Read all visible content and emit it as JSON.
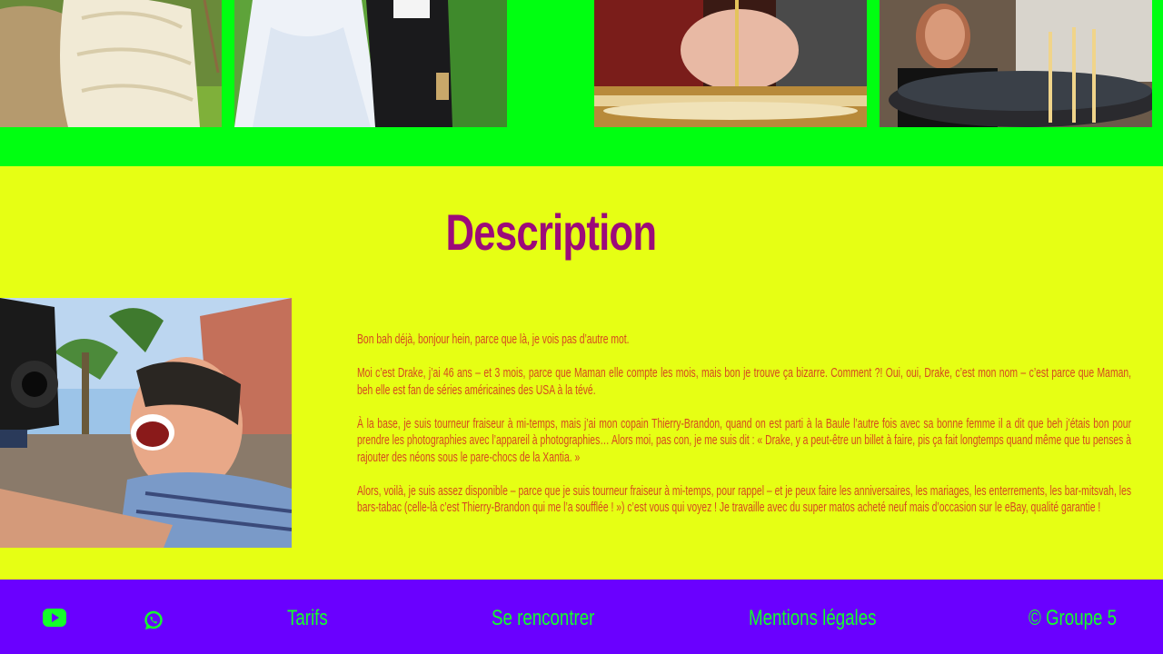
{
  "description": {
    "title": "Description",
    "paragraphs": [
      "Bon bah déjà, bonjour hein, parce que là, je vois pas d’autre mot.",
      "Moi c’est Drake, j’ai 46 ans – et 3 mois, parce que Maman elle compte les mois, mais bon je trouve ça bizarre. Comment ?! Oui, oui, Drake, c’est mon nom – c’est parce que Maman, beh elle est fan de séries américaines des USA à la tévé.",
      "À la base, je suis tourneur fraiseur à mi-temps, mais j’ai mon copain Thierry-Brandon, quand on est parti à la Baule l’autre fois avec sa bonne femme il a dit que beh j’étais bon pour prendre les photographies avec l’appareil à photographies… Alors moi, pas con, je me suis dit : « Drake, y a peut-être un billet à faire, pis ça fait longtemps quand même que tu penses à rajouter des néons sous le pare-chocs de la Xantia. »",
      "Alors, voilà, je suis assez disponible – parce que je suis tourneur fraiseur à mi-temps, pour rappel – et je peux faire les anniversaires, les mariages, les enterrements, les bar-mitsvah, les bars-tabac (celle-là c’est Thierry-Brandon qui me l’a soufflée ! ») c’est vous qui voyez ! Je travaille avec du super matos acheté neuf mais d’occasion sur le eBay, qualité garantie !"
    ]
  },
  "footer": {
    "youtube_icon": "youtube-icon",
    "whatsapp_icon": "whatsapp-icon",
    "tarifs": "Tarifs",
    "rencontrer": "Se rencontrer",
    "mentions": "Mentions légales",
    "copyright": "© Groupe 5"
  },
  "colors": {
    "gallery_bg": "#00ff11",
    "section_bg": "#e6ff14",
    "title": "#9c0a7a",
    "body_text": "#d54820",
    "footer_bg": "#6a00ff",
    "footer_text": "#14ff2a"
  }
}
